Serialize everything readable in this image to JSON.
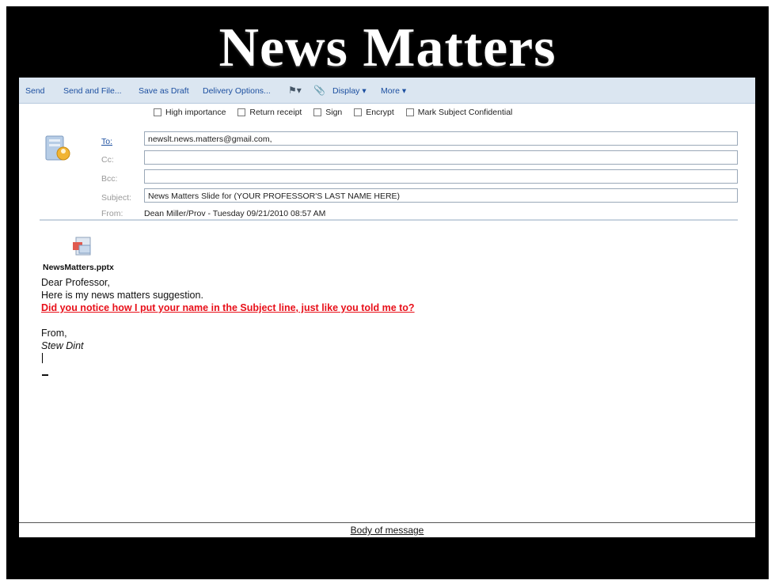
{
  "slide": {
    "title": "News Matters"
  },
  "toolbar": {
    "send": "Send",
    "send_and_file": "Send and File...",
    "save_as_draft": "Save as Draft",
    "delivery_options": "Delivery Options...",
    "flag_icon": "flag-icon",
    "attach_icon": "paperclip-icon",
    "display": "Display ▾",
    "more": "More ▾"
  },
  "options": {
    "high_importance": "High importance",
    "return_receipt": "Return receipt",
    "sign": "Sign",
    "encrypt": "Encrypt",
    "mark_confidential": "Mark Subject Confidential"
  },
  "header": {
    "to_label": "To:",
    "to_value": "newslt.news.matters@gmail.com,",
    "cc_label": "Cc:",
    "cc_value": "",
    "bcc_label": "Bcc:",
    "bcc_value": "",
    "subject_label": "Subject:",
    "subject_value": "News Matters Slide for (YOUR PROFESSOR'S LAST NAME HERE)",
    "from_label": "From:",
    "from_value": "Dean Miller/Prov - Tuesday 09/21/2010 08:57 AM"
  },
  "attachment": {
    "name": "NewsMatters.pptx"
  },
  "body": {
    "greeting": "Dear Professor,",
    "line1": "Here is my news matters suggestion.",
    "line2": "Did you notice how I put your name in the Subject line, just like you told me to?",
    "closing": "From,",
    "signature": "Stew Dint"
  },
  "caption": "Body of message",
  "colors": {
    "accent": "#1c4fa0",
    "toolbar_bg": "#dbe6f1",
    "highlight": "#e8101a"
  }
}
